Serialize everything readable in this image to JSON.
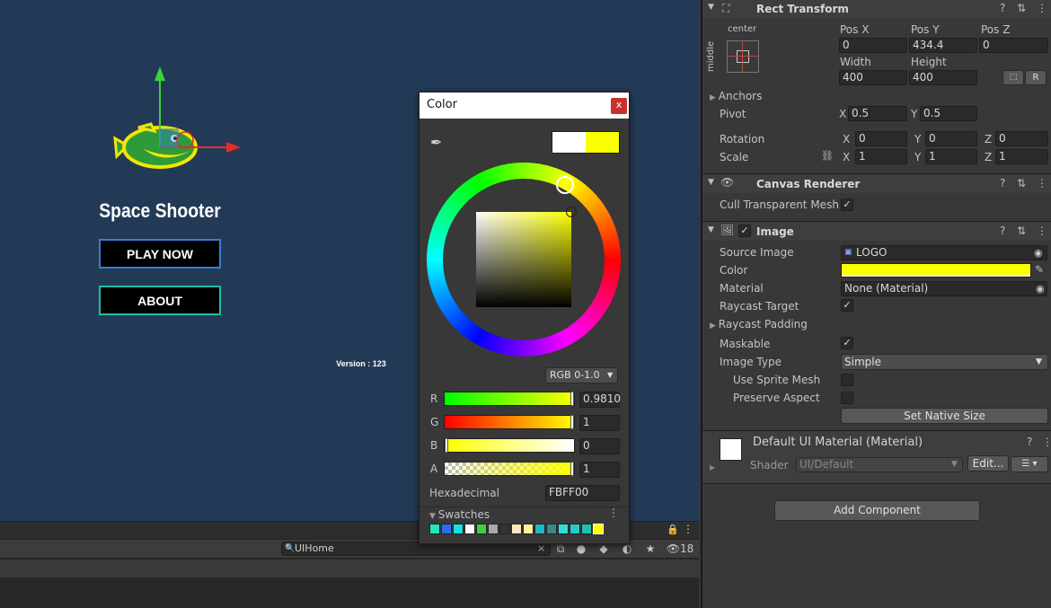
{
  "scene": {
    "title": "Space Shooter",
    "play_button": "PLAY NOW",
    "about_button": "ABOUT",
    "version": "Version : 123"
  },
  "toolbar": {
    "search_value": "UIHome",
    "hidden_count": "18"
  },
  "color_picker": {
    "title": "Color",
    "close": "x",
    "mode": "RGB 0-1.0",
    "channels": [
      {
        "label": "R",
        "value": "0.9810"
      },
      {
        "label": "G",
        "value": "1"
      },
      {
        "label": "B",
        "value": "0"
      },
      {
        "label": "A",
        "value": "1"
      }
    ],
    "hex_label": "Hexadecimal",
    "hex_value": "FBFF00",
    "swatches_label": "Swatches",
    "current_color": "#FBFF00",
    "swatch_colors": [
      "#1de9b6",
      "#2d6cf0",
      "#18e0e0",
      "#ffffff",
      "#3fd13f",
      "#a8a8a8",
      "#333333",
      "#ffe8c0",
      "#fff2a0",
      "#20b8c8",
      "#3a8a8a",
      "#33dddd",
      "#2ac9c9",
      "#20c0b0",
      "#fbff00"
    ]
  },
  "inspector": {
    "rect_transform": {
      "title": "Rect Transform",
      "anchor_h": "center",
      "anchor_v": "middle",
      "pos_x_label": "Pos X",
      "pos_x": "0",
      "pos_y_label": "Pos Y",
      "pos_y": "434.4",
      "pos_z_label": "Pos Z",
      "pos_z": "0",
      "width_label": "Width",
      "width": "400",
      "height_label": "Height",
      "height": "400",
      "r_button": "R",
      "anchors_label": "Anchors",
      "pivot_label": "Pivot",
      "pivot_x": "0.5",
      "pivot_y": "0.5",
      "rotation_label": "Rotation",
      "rot_x": "0",
      "rot_y": "0",
      "rot_z": "0",
      "scale_label": "Scale",
      "scale_x": "1",
      "scale_y": "1",
      "scale_z": "1",
      "x": "X",
      "y": "Y",
      "z": "Z"
    },
    "canvas_renderer": {
      "title": "Canvas Renderer",
      "cull_label": "Cull Transparent Mesh"
    },
    "image": {
      "title": "Image",
      "source_label": "Source Image",
      "source_value": "LOGO",
      "color_label": "Color",
      "material_label": "Material",
      "material_value": "None (Material)",
      "raycast_target_label": "Raycast Target",
      "raycast_padding_label": "Raycast Padding",
      "maskable_label": "Maskable",
      "image_type_label": "Image Type",
      "image_type_value": "Simple",
      "use_sprite_mesh_label": "Use Sprite Mesh",
      "preserve_aspect_label": "Preserve Aspect",
      "set_native_size": "Set Native Size"
    },
    "material": {
      "title": "Default UI Material (Material)",
      "shader_label": "Shader",
      "shader_value": "UI/Default",
      "edit_button": "Edit..."
    },
    "add_component": "Add Component"
  }
}
